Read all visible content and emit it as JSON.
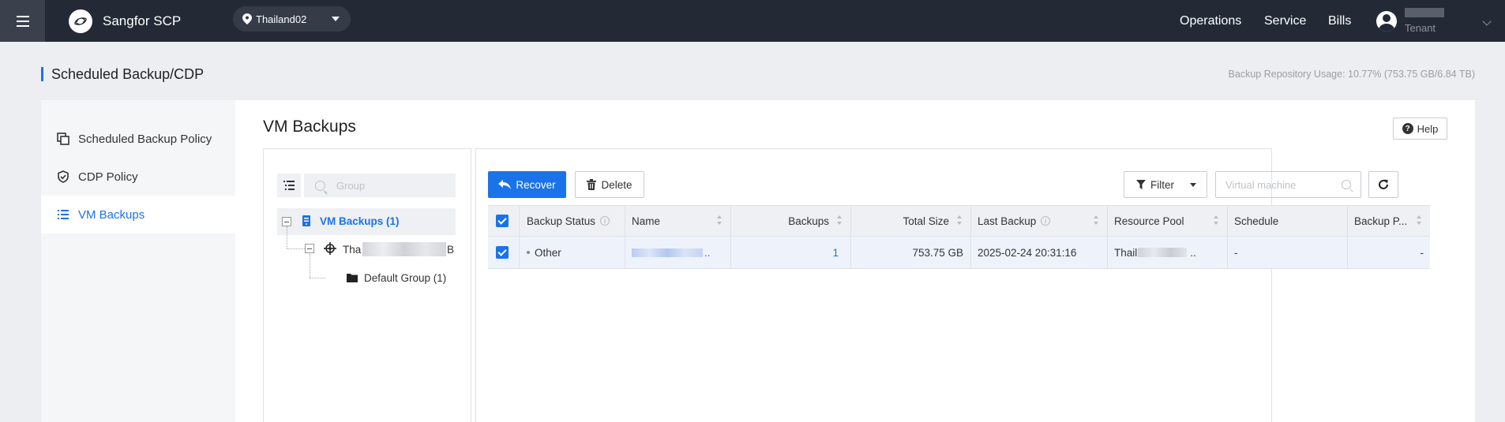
{
  "topbar": {
    "brand_name": "Sangfor SCP",
    "region": "Thailand02",
    "nav": [
      "Operations",
      "Service",
      "Bills"
    ],
    "user_role": "Tenant"
  },
  "page": {
    "title": "Scheduled Backup/CDP",
    "repo_usage": "Backup Repository Usage: 10.77% (753.75 GB/6.84 TB)"
  },
  "leftnav": {
    "items": [
      {
        "label": "Scheduled Backup Policy",
        "icon": "copy-icon"
      },
      {
        "label": "CDP Policy",
        "icon": "shield-check-icon"
      },
      {
        "label": "VM Backups",
        "icon": "list-icon",
        "active": true
      }
    ]
  },
  "main": {
    "title": "VM Backups",
    "help_label": "Help"
  },
  "tree": {
    "search_placeholder": "Group",
    "root_label": "VM Backups  (1)",
    "child_label_prefix": "Tha",
    "child_label_suffix": "B",
    "group_label": "Default Group (1)"
  },
  "toolbar": {
    "recover_label": "Recover",
    "delete_label": "Delete",
    "filter_label": "Filter",
    "search_placeholder": "Virtual machine"
  },
  "table": {
    "columns": [
      "Backup Status",
      "Name",
      "Backups",
      "Total Size",
      "Last Backup",
      "Resource Pool",
      "Schedule",
      "Backup P..."
    ],
    "rows": [
      {
        "status": "Other",
        "name_suffix": "..",
        "backups": "1",
        "total_size": "753.75 GB",
        "last_backup": "2025-02-24 20:31:16",
        "resource_pool_prefix": "Thail",
        "resource_pool_suffix": "..",
        "schedule": "-",
        "backup_policy": "-"
      }
    ]
  },
  "colors": {
    "accent": "#1a73e8",
    "topbar_bg": "#232a36",
    "page_bg": "#eceef1"
  }
}
